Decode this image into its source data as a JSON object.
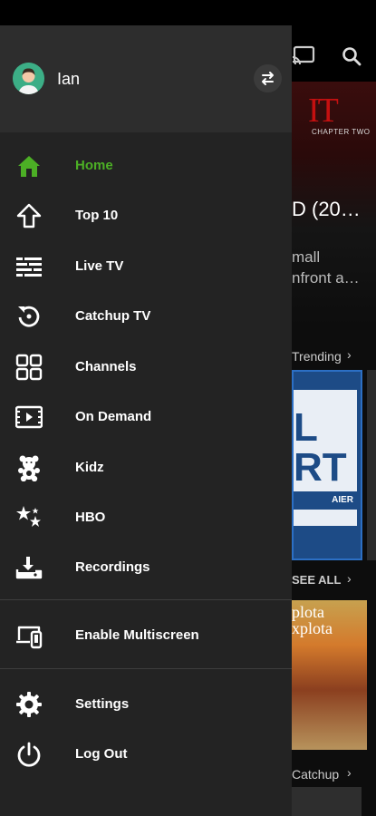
{
  "background": {
    "hero_logo": "IT",
    "hero_subtitle": "CHAPTER TWO",
    "hero_title": "D  (20…",
    "hero_desc_line1": "mall",
    "hero_desc_line2": "nfront a…",
    "row1_label": "Trending",
    "row2_label": "SEE ALL",
    "row3_label": "Catchup",
    "thumb1_text": "L\nRT",
    "thumb1_sub": "AIER",
    "thumb3_text": "plota\nxplota",
    "chevron": "›"
  },
  "user": {
    "name": "Ian"
  },
  "colors": {
    "active": "#4caf25",
    "drawer": "#232323",
    "header": "#2d2d2d"
  },
  "menu": [
    {
      "label": "Home",
      "icon": "home-icon",
      "active": true
    },
    {
      "label": "Top 10",
      "icon": "arrow-up-icon"
    },
    {
      "label": "Live TV",
      "icon": "live-tv-icon"
    },
    {
      "label": "Catchup TV",
      "icon": "replay-icon"
    },
    {
      "label": "Channels",
      "icon": "grid-icon"
    },
    {
      "label": "On Demand",
      "icon": "video-icon"
    },
    {
      "label": "Kidz",
      "icon": "teddy-bear-icon"
    },
    {
      "label": "HBO",
      "icon": "stars-icon"
    },
    {
      "label": "Recordings",
      "icon": "download-icon"
    }
  ],
  "extra": [
    {
      "label": "Enable Multiscreen",
      "icon": "multiscreen-icon"
    },
    {
      "label": "Settings",
      "icon": "gear-icon"
    },
    {
      "label": "Log Out",
      "icon": "power-icon"
    }
  ]
}
